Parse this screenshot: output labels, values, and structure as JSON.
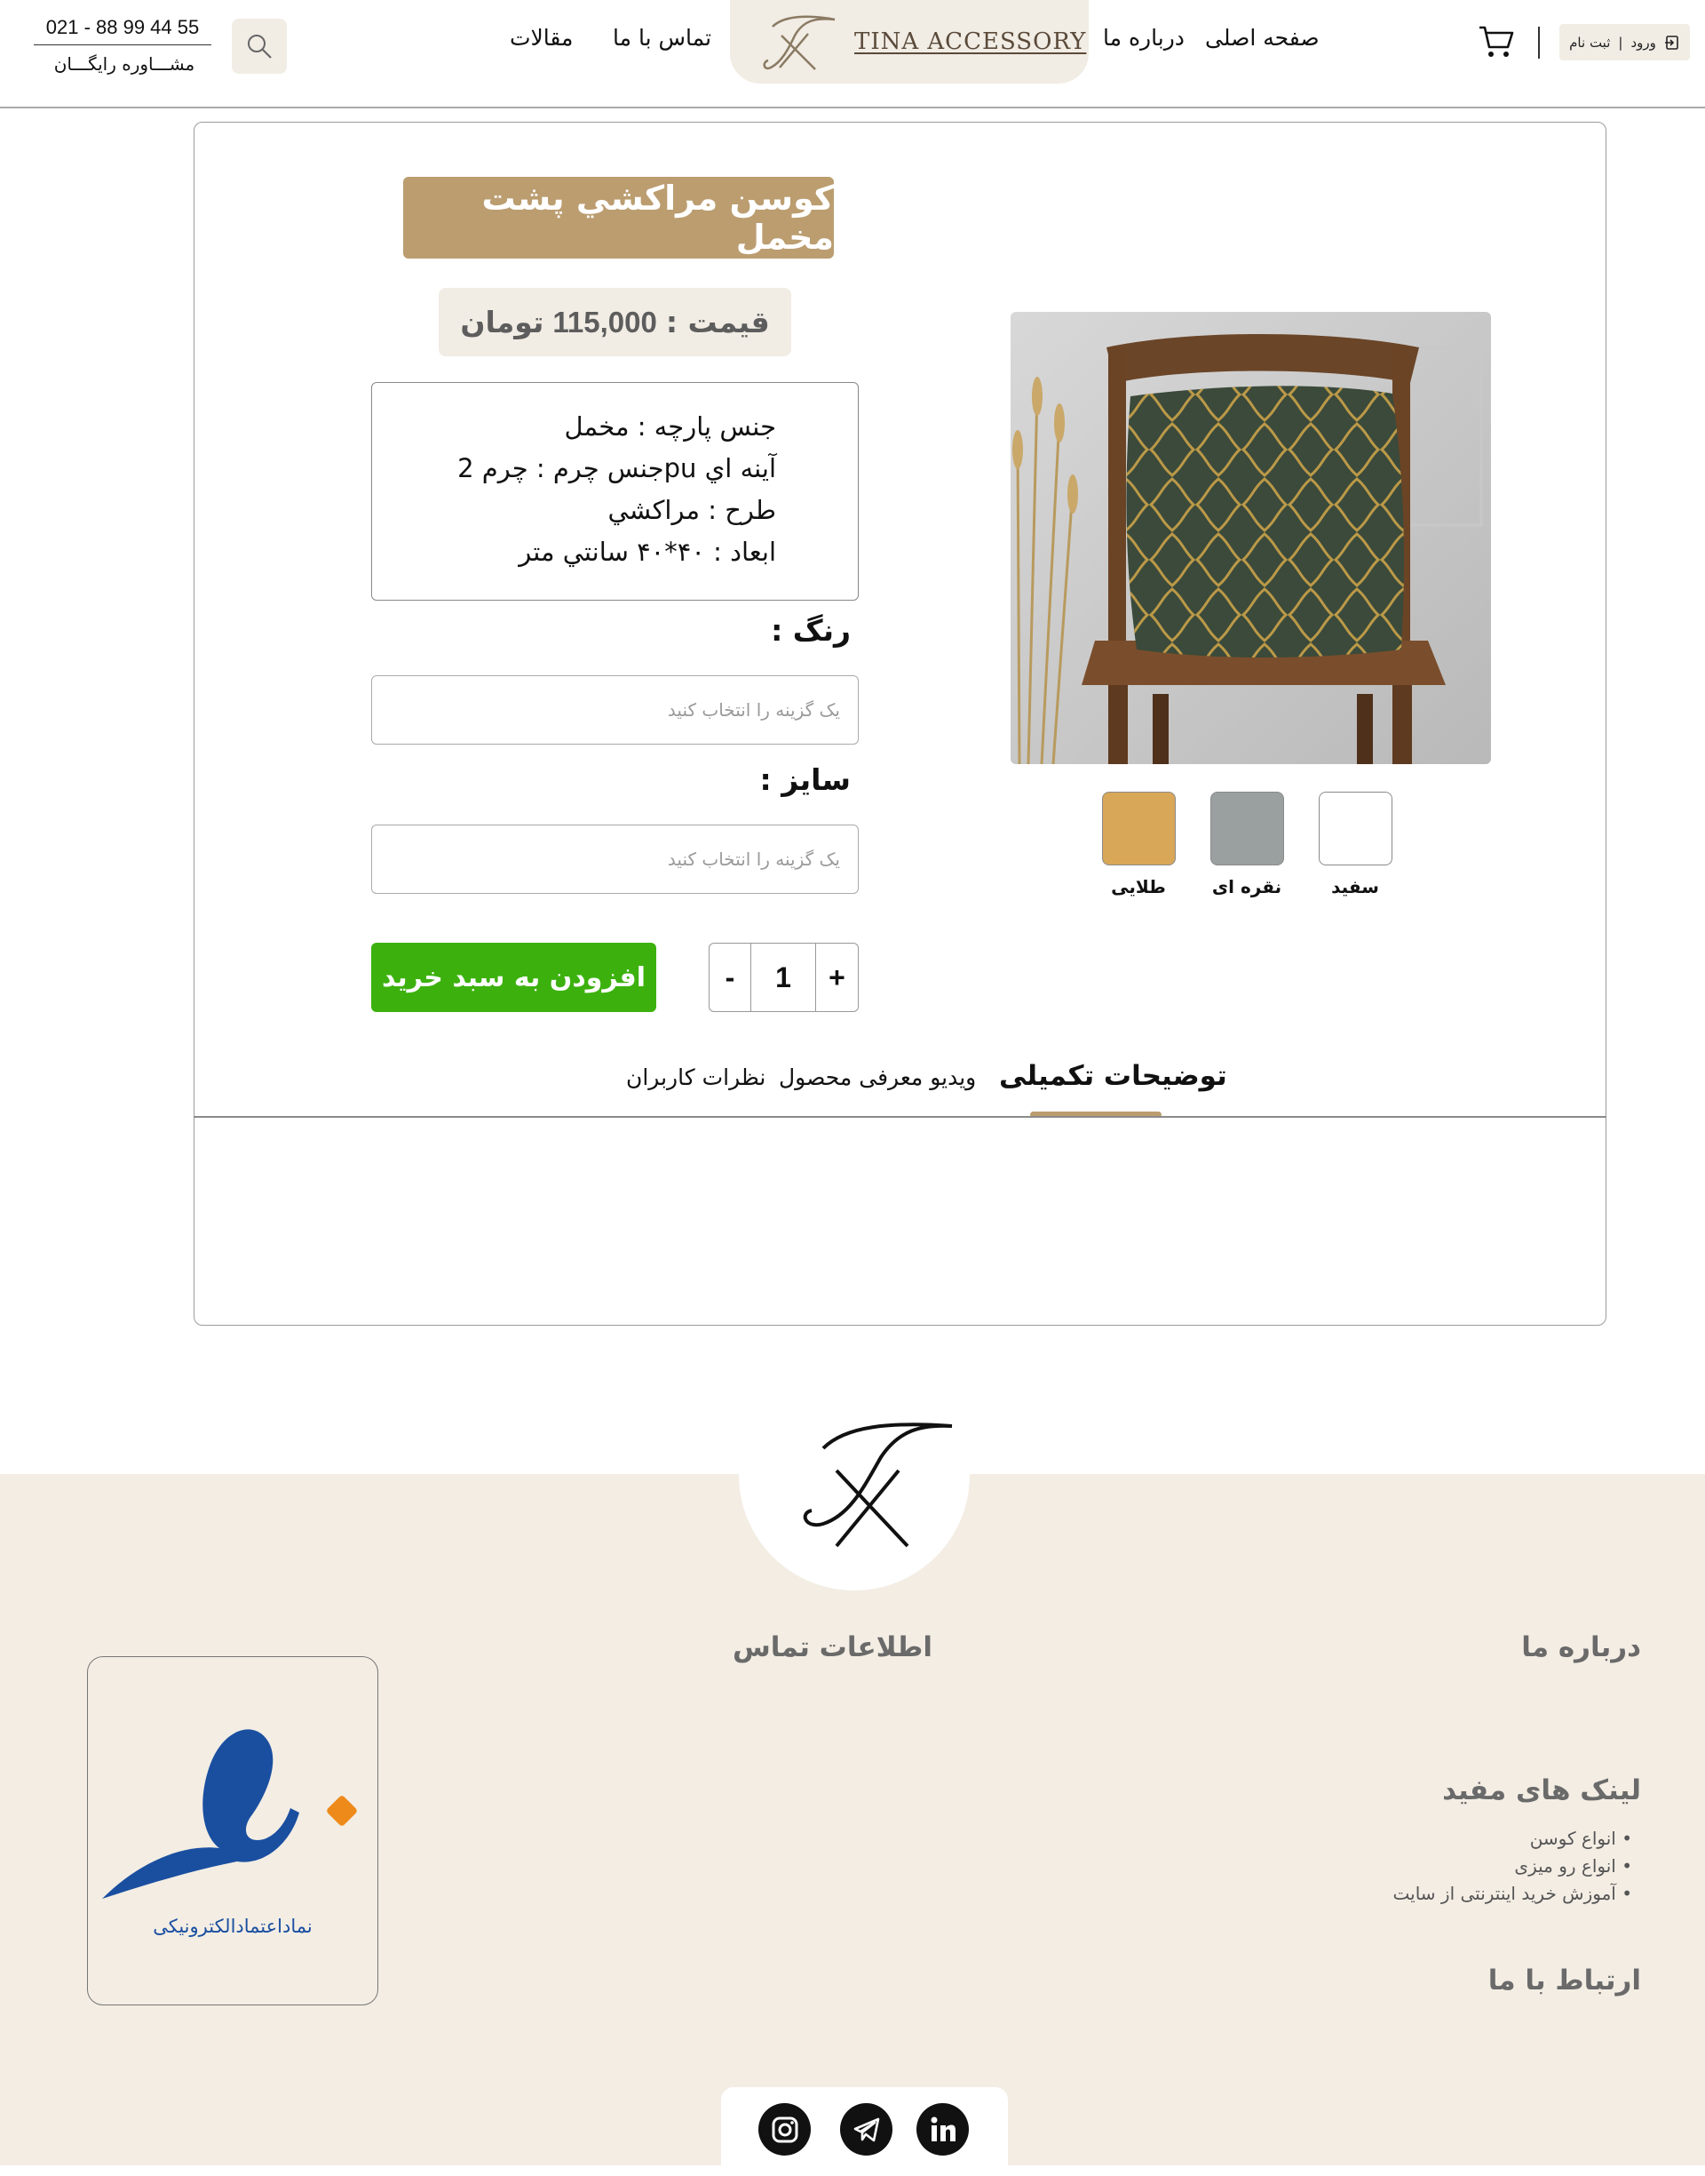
{
  "header": {
    "login_label": "ورود",
    "register_label": "ثبت نام",
    "nav": {
      "home": "صفحه اصلی",
      "about": "درباره ما",
      "contact": "تماس با ما",
      "articles": "مقالات"
    },
    "logo_text": "TINA ACCESSORY",
    "phone": "021 - 88 99 44 55",
    "free_advice": "مشـــاوره رایگـــان"
  },
  "product": {
    "title": "كوسن مراكشي پشت مخمل",
    "price_label": "قیمت :",
    "price_value": "115,000",
    "price_currency": "تومان",
    "specs": [
      "جنس پارچه : مخمل",
      "آينه اي puجنس چرم : چرم 2",
      "طرح : مراكشي",
      "ابعاد : ۴۰*۴۰ سانتي متر"
    ],
    "color_label": "رنگ :",
    "color_placeholder": "یک گزینه را انتخاب کنید",
    "size_label": "سایز :",
    "size_placeholder": "یک گزینه را انتخاب کنید",
    "add_to_cart": "افزودن به سبد خرید",
    "quantity": "1",
    "qty_plus": "+",
    "qty_minus": "-",
    "swatches": [
      {
        "label": "سفید",
        "color": "#ffffff"
      },
      {
        "label": "نقره ای",
        "color": "#9a9fa0"
      },
      {
        "label": "طلایی",
        "color": "#d9a758"
      }
    ]
  },
  "tabs": {
    "description": "توضیحات تکمیلی",
    "video": "ویدیو معرفی محصول",
    "reviews": "نظرات کاربران"
  },
  "footer": {
    "about_heading": "درباره ما",
    "contact_heading": "اطلاعات تماس",
    "links_heading": "لینک های مفید",
    "links": [
      "• انواع کوسن",
      "• انواع رو میزی",
      "• آموزش خرید اینترنتی از سایت"
    ],
    "connect_heading": "ارتباط با ما",
    "enamad_text": "نماداعتمادالکترونیکی"
  },
  "colors": {
    "accent": "#bb9d70",
    "cream": "#f1ece4",
    "cta_green": "#3cb10e",
    "footer_bg": "#f3ede4"
  },
  "icons": [
    "login-icon",
    "cart-icon",
    "search-icon",
    "instagram-icon",
    "telegram-icon",
    "linkedin-icon"
  ]
}
